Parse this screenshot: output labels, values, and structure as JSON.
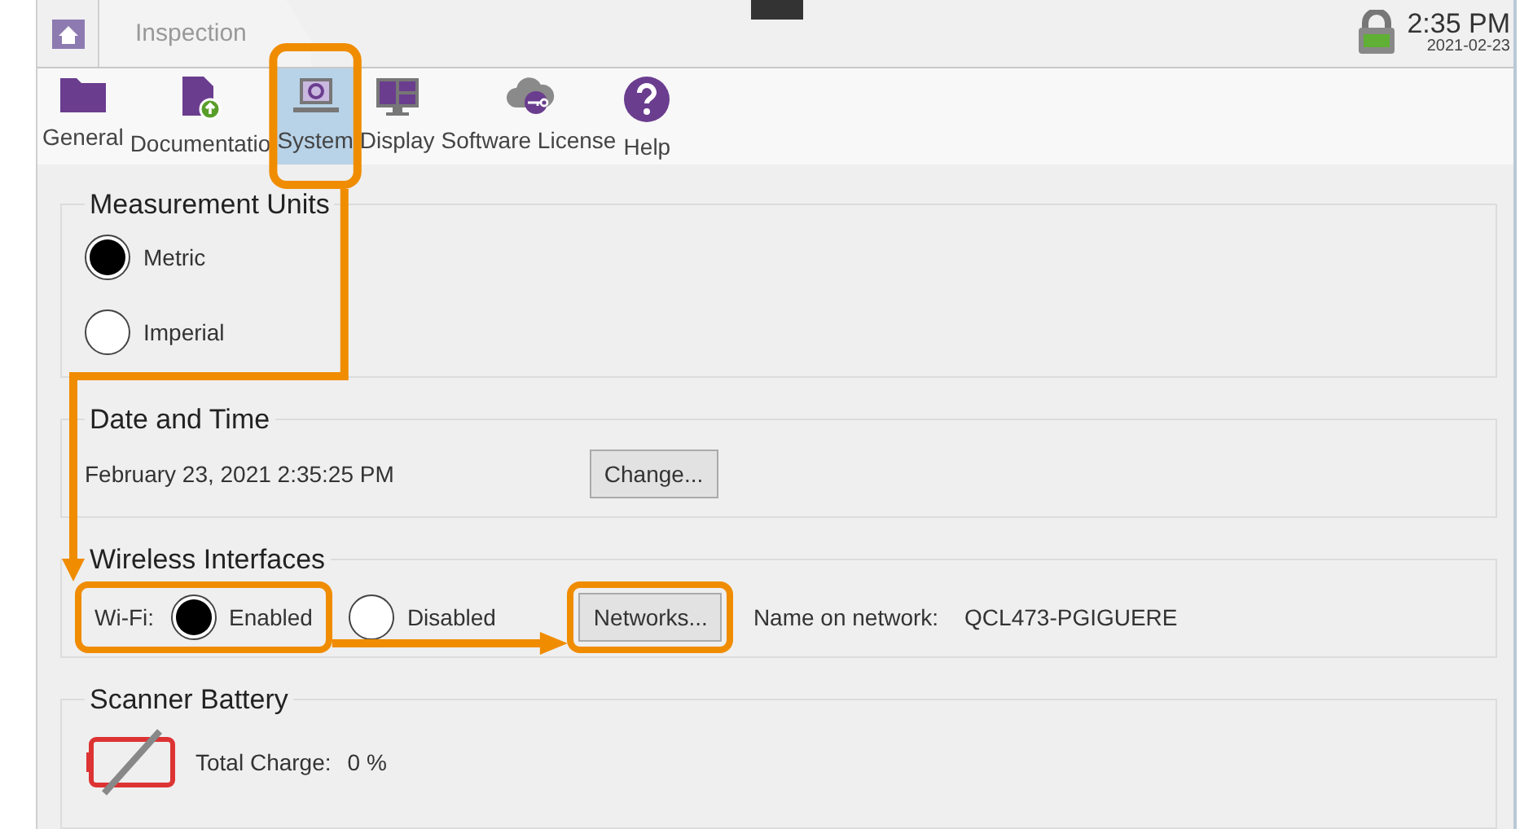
{
  "header": {
    "tab": "Inspection",
    "time": "2:35 PM",
    "date": "2021-02-23"
  },
  "toolbar": [
    {
      "label": "General",
      "kind": "folder",
      "selected": false
    },
    {
      "label": "Documentatio",
      "kind": "document",
      "selected": false
    },
    {
      "label": "System",
      "kind": "laptop",
      "selected": true
    },
    {
      "label": "Display",
      "kind": "display",
      "selected": false
    },
    {
      "label": "Software License",
      "kind": "cloud",
      "selected": false
    },
    {
      "label": "Help",
      "kind": "help",
      "selected": false
    }
  ],
  "sections": [
    {
      "title": "Measurement Units",
      "kind": "radios",
      "options": [
        {
          "label": "Metric",
          "selected": true
        },
        {
          "label": "Imperial",
          "selected": false
        }
      ]
    },
    {
      "title": "Date and Time",
      "kind": "datetime",
      "value": "February 23, 2021 2:35:25 PM",
      "button": "Change..."
    },
    {
      "title": "Wireless Interfaces",
      "kind": "wifi",
      "label": "Wi-Fi:",
      "options": [
        {
          "label": "Enabled",
          "selected": true
        },
        {
          "label": "Disabled",
          "selected": false
        }
      ],
      "button": "Networks...",
      "network_label": "Name on network:",
      "network": "QCL473-PGIGUERE"
    },
    {
      "title": "Scanner Battery",
      "kind": "battery",
      "label": "Total Charge:",
      "value": "0 %"
    }
  ]
}
